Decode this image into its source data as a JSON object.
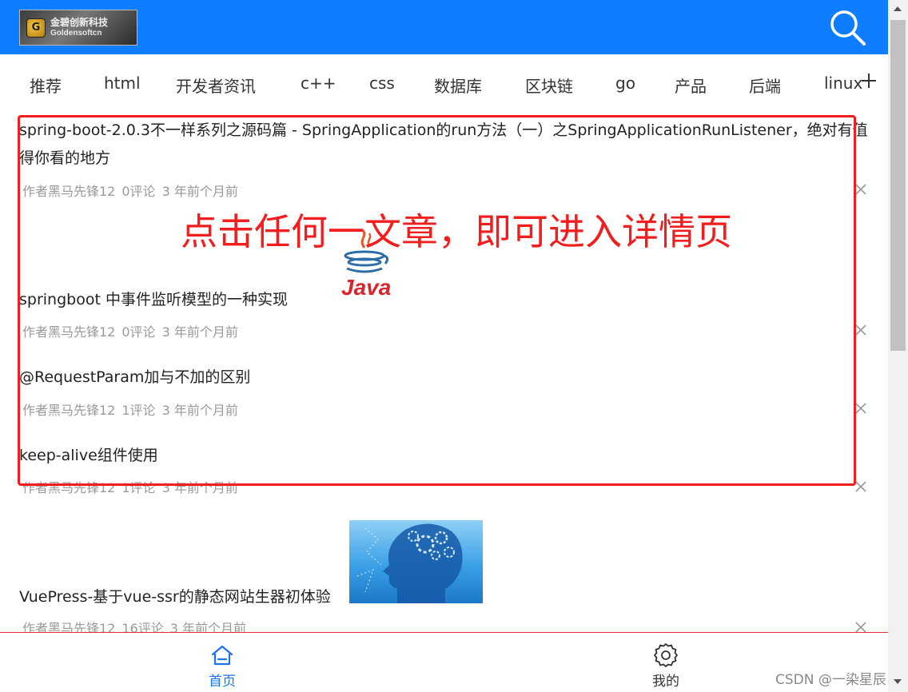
{
  "header": {
    "logo_cn": "金碧创新科技",
    "logo_en": "Goldensoftcn",
    "bg_color": "#0f7dff"
  },
  "tabs": [
    {
      "label": "推荐"
    },
    {
      "label": "html"
    },
    {
      "label": "开发者资讯"
    },
    {
      "label": "c++"
    },
    {
      "label": "css"
    },
    {
      "label": "数据库"
    },
    {
      "label": "区块链"
    },
    {
      "label": "go"
    },
    {
      "label": "产品"
    },
    {
      "label": "后端"
    },
    {
      "label": "linux"
    }
  ],
  "articles": [
    {
      "title": "spring-boot-2.0.3不一样系列之源码篇 - SpringApplication的run方法（一）之SpringApplicationRunListener，绝对有值得你看的地方",
      "author": "作者黑马先锋12",
      "comments": "0评论",
      "time": "3 年前个月前"
    },
    {
      "title": "springboot 中事件监听模型的一种实现",
      "author": "作者黑马先锋12",
      "comments": "0评论",
      "time": "3 年前个月前",
      "image_text": "Java"
    },
    {
      "title": "@RequestParam加与不加的区别",
      "author": "作者黑马先锋12",
      "comments": "1评论",
      "time": "3 年前个月前"
    },
    {
      "title": "keep-alive组件使用",
      "author": "作者黑马先锋12",
      "comments": "1评论",
      "time": "3 年前个月前"
    },
    {
      "title": "VuePress-基于vue-ssr的静态网站生器初体验",
      "author": "作者黑马先锋12",
      "comments": "16评论",
      "time": "3 年前个月前"
    }
  ],
  "annotation": {
    "text": "点击任何一文章，即可进入详情页",
    "color": "#f21d1d"
  },
  "bottom_nav": [
    {
      "label": "首页",
      "active": true,
      "color": "#1a73e8"
    },
    {
      "label": "我的",
      "active": false,
      "color": "#333333"
    }
  ],
  "watermark": "CSDN @一染星辰"
}
